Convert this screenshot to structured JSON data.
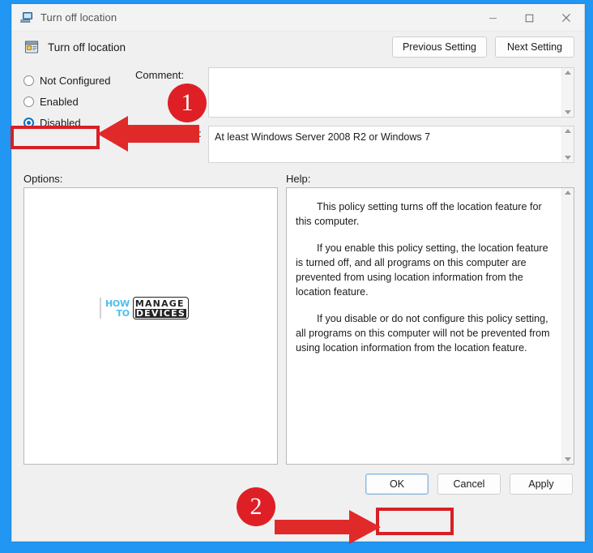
{
  "window": {
    "title": "Turn off location",
    "title_icon": "computer-monitor-icon",
    "minimize_label": "—",
    "maximize_label": "□",
    "close_label": "✕"
  },
  "header": {
    "policy_icon": "group-policy-setting-icon",
    "policy_name": "Turn off location",
    "previous_setting_label": "Previous Setting",
    "next_setting_label": "Next Setting"
  },
  "state_options": [
    {
      "label": "Not Configured",
      "checked": false
    },
    {
      "label": "Enabled",
      "checked": false
    },
    {
      "label": "Disabled",
      "checked": true
    }
  ],
  "fields": {
    "comment_label": "Comment:",
    "comment_value": "",
    "supported_label": "Supported on:",
    "supported_value": "At least Windows Server 2008 R2 or Windows 7"
  },
  "panels": {
    "options_label": "Options:",
    "help_label": "Help:",
    "options_content": "",
    "help_paragraphs": [
      "This policy setting turns off the location feature for this computer.",
      "If you enable this policy setting, the location feature is turned off, and all programs on this computer are prevented from using location information from the location feature.",
      "If you disable or do not configure this policy setting, all programs on this computer will not be prevented from using location information from the location feature."
    ]
  },
  "watermark": {
    "line1": "HOW",
    "line2": "TO",
    "word1": "MANAGE",
    "word2": "DEVICES"
  },
  "buttons": {
    "ok_label": "OK",
    "cancel_label": "Cancel",
    "apply_label": "Apply"
  },
  "annotations": {
    "badge_1": "1",
    "badge_2": "2",
    "arrow_1_target": "disabled-radio",
    "arrow_2_target": "ok-button",
    "highlight_color": "#d81f26"
  },
  "colors": {
    "desktop_blue": "#2196f3",
    "annotation_red": "#de2026",
    "radio_accent": "#0a72c4",
    "watermark_cyan": "#3fb8ef"
  }
}
